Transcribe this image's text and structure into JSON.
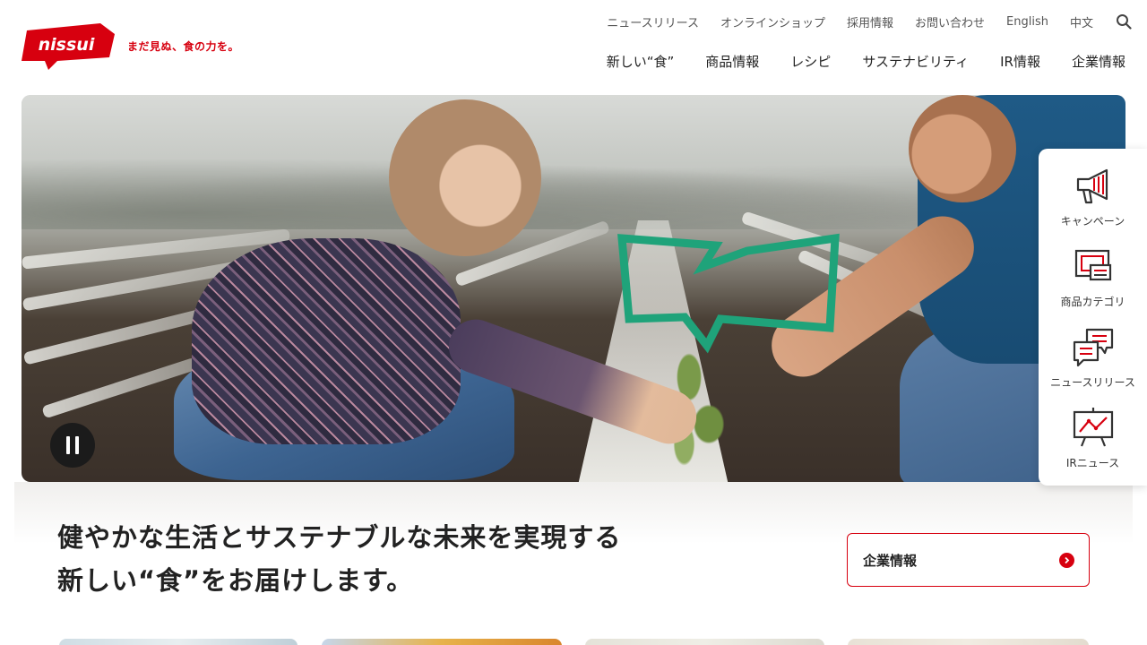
{
  "brand": {
    "logo_text": "nissui",
    "tagline": "まだ見ぬ、食の力を。",
    "colors": {
      "primary": "#d7000f",
      "accent_green": "#1fa37a"
    }
  },
  "util_nav": {
    "items": [
      "ニュースリリース",
      "オンラインショップ",
      "採用情報",
      "お問い合わせ",
      "English",
      "中文"
    ],
    "search_icon": "search-icon"
  },
  "main_nav": {
    "items": [
      "新しい“食”",
      "商品情報",
      "レシピ",
      "サステナビリティ",
      "IR情報",
      "企業情報"
    ]
  },
  "hero": {
    "pause_icon": "pause-icon"
  },
  "side_nav": {
    "items": [
      {
        "label": "キャンペーン",
        "icon": "megaphone-icon"
      },
      {
        "label": "商品カテゴリ",
        "icon": "product-category-icon"
      },
      {
        "label": "ニュースリリース",
        "icon": "chat-bubble-icon"
      },
      {
        "label": "IRニュース",
        "icon": "chart-board-icon"
      }
    ]
  },
  "intro": {
    "line1": "健やかな生活とサステナブルな未来を実現する",
    "line2": "新しい“食”をお届けします。",
    "cta_label": "企業情報",
    "cta_icon": "chevron-right-icon"
  }
}
